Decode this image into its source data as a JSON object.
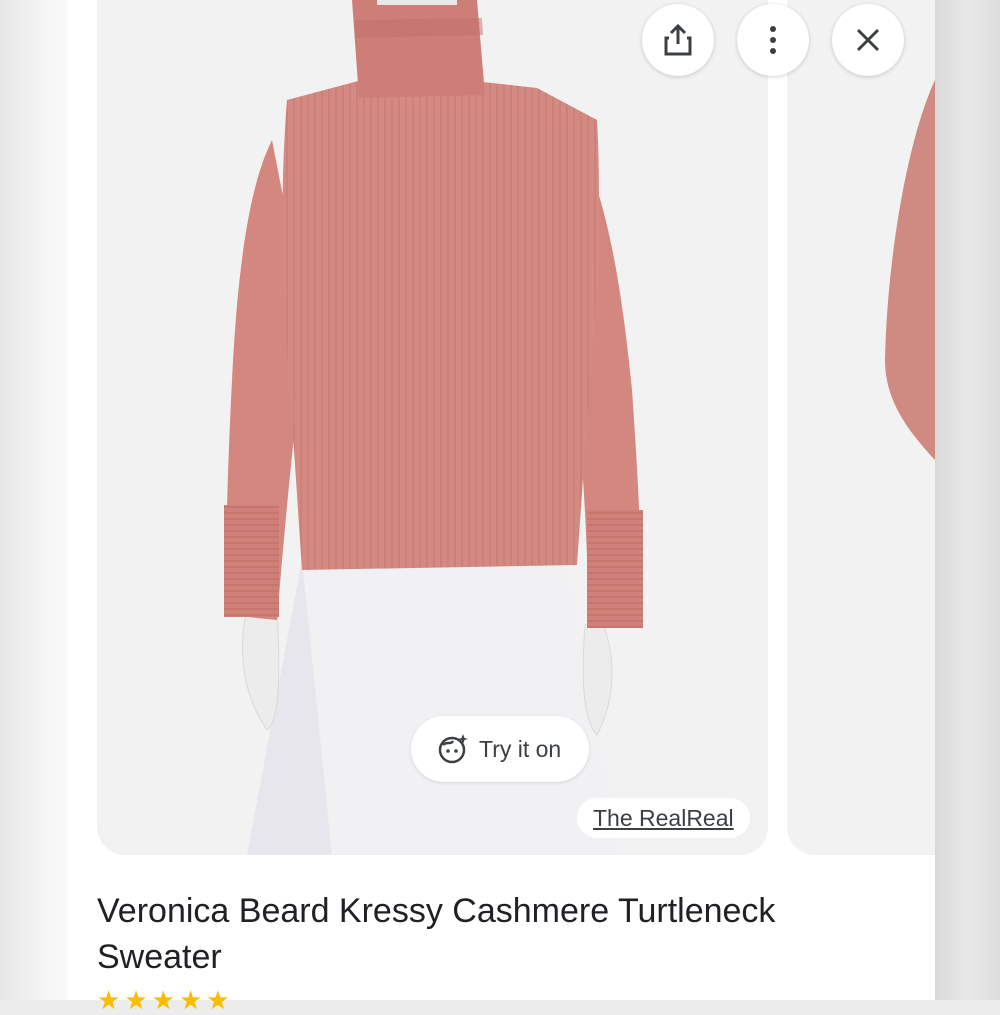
{
  "viewer": {
    "actions": {
      "share_icon": "share-icon",
      "more_icon": "more-vert-icon",
      "close_icon": "close-icon"
    },
    "image": {
      "subject": "mannequin wearing pink ribbed turtleneck sweater and white skirt",
      "sweater_color": "#d4877f",
      "skirt_color": "#f1f1f4"
    },
    "try_on": {
      "label": "Try it on",
      "icon": "sparkle-face-icon"
    },
    "source": {
      "label": "The RealReal"
    }
  },
  "product": {
    "title": "Veronica Beard Kressy Cashmere Turtleneck Sweater",
    "rating_star_color": "#fbbc04"
  }
}
